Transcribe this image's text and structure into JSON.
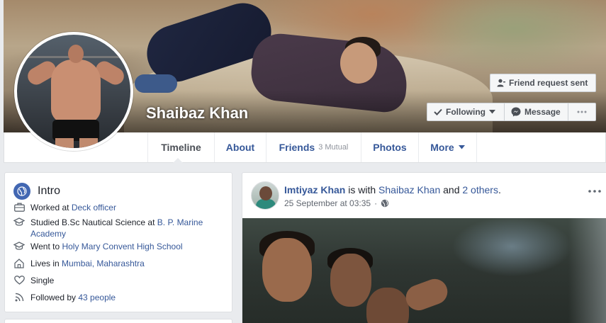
{
  "profile": {
    "name": "Shaibaz Khan"
  },
  "actions": {
    "friend_request": "Friend request sent",
    "following": "Following",
    "message": "Message"
  },
  "tabs": {
    "timeline": "Timeline",
    "about": "About",
    "friends": "Friends",
    "friends_mutual": "3 Mutual",
    "photos": "Photos",
    "more": "More"
  },
  "intro": {
    "title": "Intro",
    "work_prefix": "Worked at ",
    "work_place": "Deck officer",
    "study_prefix": "Studied B.Sc Nautical Science at ",
    "study_place": "B. P. Marine Academy",
    "school_prefix": "Went to ",
    "school_place": "Holy Mary Convent High School",
    "lives_prefix": "Lives in ",
    "lives_place": "Mumbai, Maharashtra",
    "relationship": "Single",
    "followed_prefix": "Followed by ",
    "followed_count": "43 people"
  },
  "post": {
    "author": "Imtiyaz Khan",
    "with_text": " is with ",
    "tagged": "Shaibaz Khan",
    "and_text": " and ",
    "others": "2 others",
    "period": ".",
    "timestamp": "25 September at 03:35",
    "dot": "·"
  },
  "colors": {
    "link": "#365899",
    "brand": "#4267b2",
    "background": "#e9ebee"
  }
}
